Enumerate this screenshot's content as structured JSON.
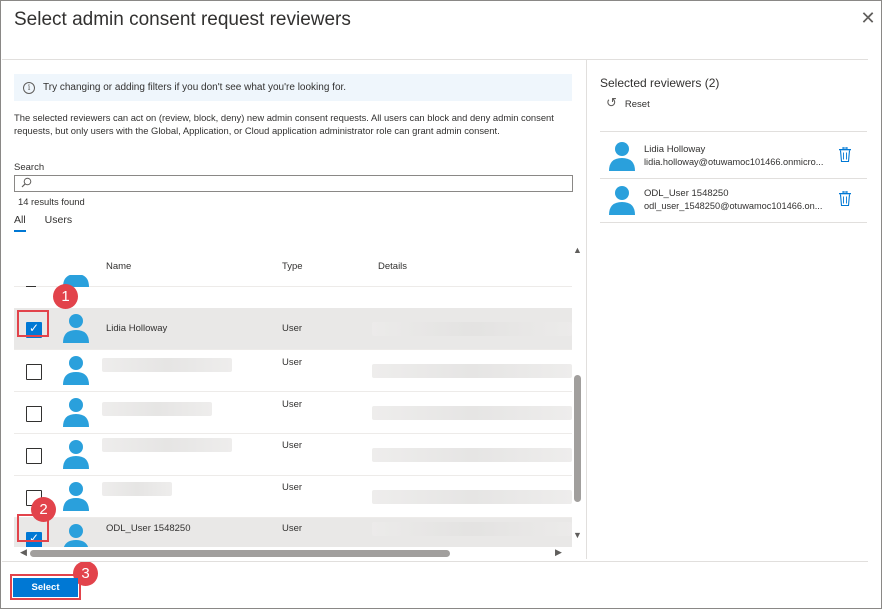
{
  "dialog": {
    "title": "Select admin consent request reviewers",
    "close_icon": "close-icon"
  },
  "info_bar": {
    "icon": "info-icon",
    "text": "Try changing or adding filters if you don't see what you're looking for."
  },
  "description": "The selected reviewers can act on (review, block, deny) new admin consent requests. All users can block and deny admin consent requests, but only users with the Global, Application, or Cloud application administrator role can grant admin consent.",
  "search": {
    "label": "Search",
    "value": "",
    "placeholder": "",
    "icon": "search-icon"
  },
  "results_text": "14 results found",
  "tabs": [
    {
      "label": "All",
      "active": true
    },
    {
      "label": "Users",
      "active": false
    }
  ],
  "table": {
    "columns": [
      "Name",
      "Type",
      "Details"
    ],
    "rows": [
      {
        "name": "Lidia Holloway",
        "type": "User",
        "checked": true,
        "selected": true
      },
      {
        "name": "",
        "type": "User",
        "checked": false,
        "selected": false
      },
      {
        "name": "",
        "type": "User",
        "checked": false,
        "selected": false
      },
      {
        "name": "",
        "type": "User",
        "checked": false,
        "selected": false
      },
      {
        "name": "",
        "type": "User",
        "checked": false,
        "selected": false
      },
      {
        "name": "ODL_User 1548250",
        "type": "User",
        "checked": true,
        "selected": true
      }
    ]
  },
  "selected_panel": {
    "title": "Selected reviewers (2)",
    "reset_label": "Reset",
    "reviewers": [
      {
        "name": "Lidia Holloway",
        "email": "lidia.holloway@otuwamoc101466.onmicro..."
      },
      {
        "name": "ODL_User 1548250",
        "email": "odl_user_1548250@otuwamoc101466.on..."
      }
    ]
  },
  "footer": {
    "select_label": "Select"
  },
  "callouts": [
    "1",
    "2",
    "3"
  ],
  "colors": {
    "accent": "#0078d4",
    "callout": "#e2434b",
    "avatar": "#2aa0dc",
    "info_bg": "#eff6fc"
  }
}
